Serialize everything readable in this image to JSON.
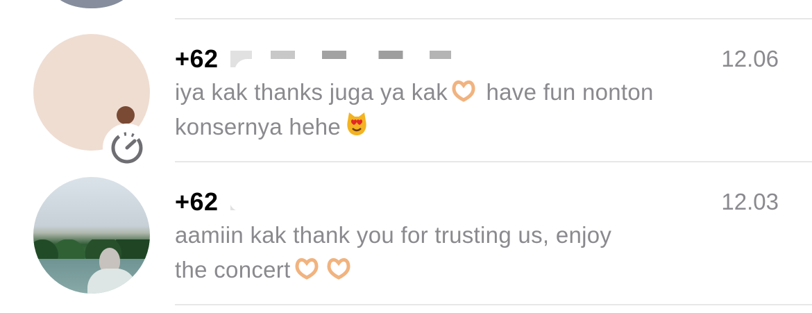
{
  "chats": [
    {
      "name": "+62",
      "time": "12.06",
      "message_part1": "iya kak thanks juga ya kak",
      "message_part2": "have fun nonton",
      "message_part3": "konsernya hehe"
    },
    {
      "name": "+62",
      "time": "12.03",
      "message_part1": "aamiin kak thank you for trusting us, enjoy",
      "message_part2": "the concert"
    }
  ],
  "icons": {
    "heart_hands": "heart-hands-icon",
    "smiling_cat_heart_eyes": "cat-heart-eyes-icon",
    "status_ring": "status-timer-icon",
    "default_profile": "profile-icon"
  },
  "colors": {
    "secondary_text": "#8a8a8e",
    "divider": "#e7e7e7",
    "default_avatar_bg": "#efddd2"
  }
}
